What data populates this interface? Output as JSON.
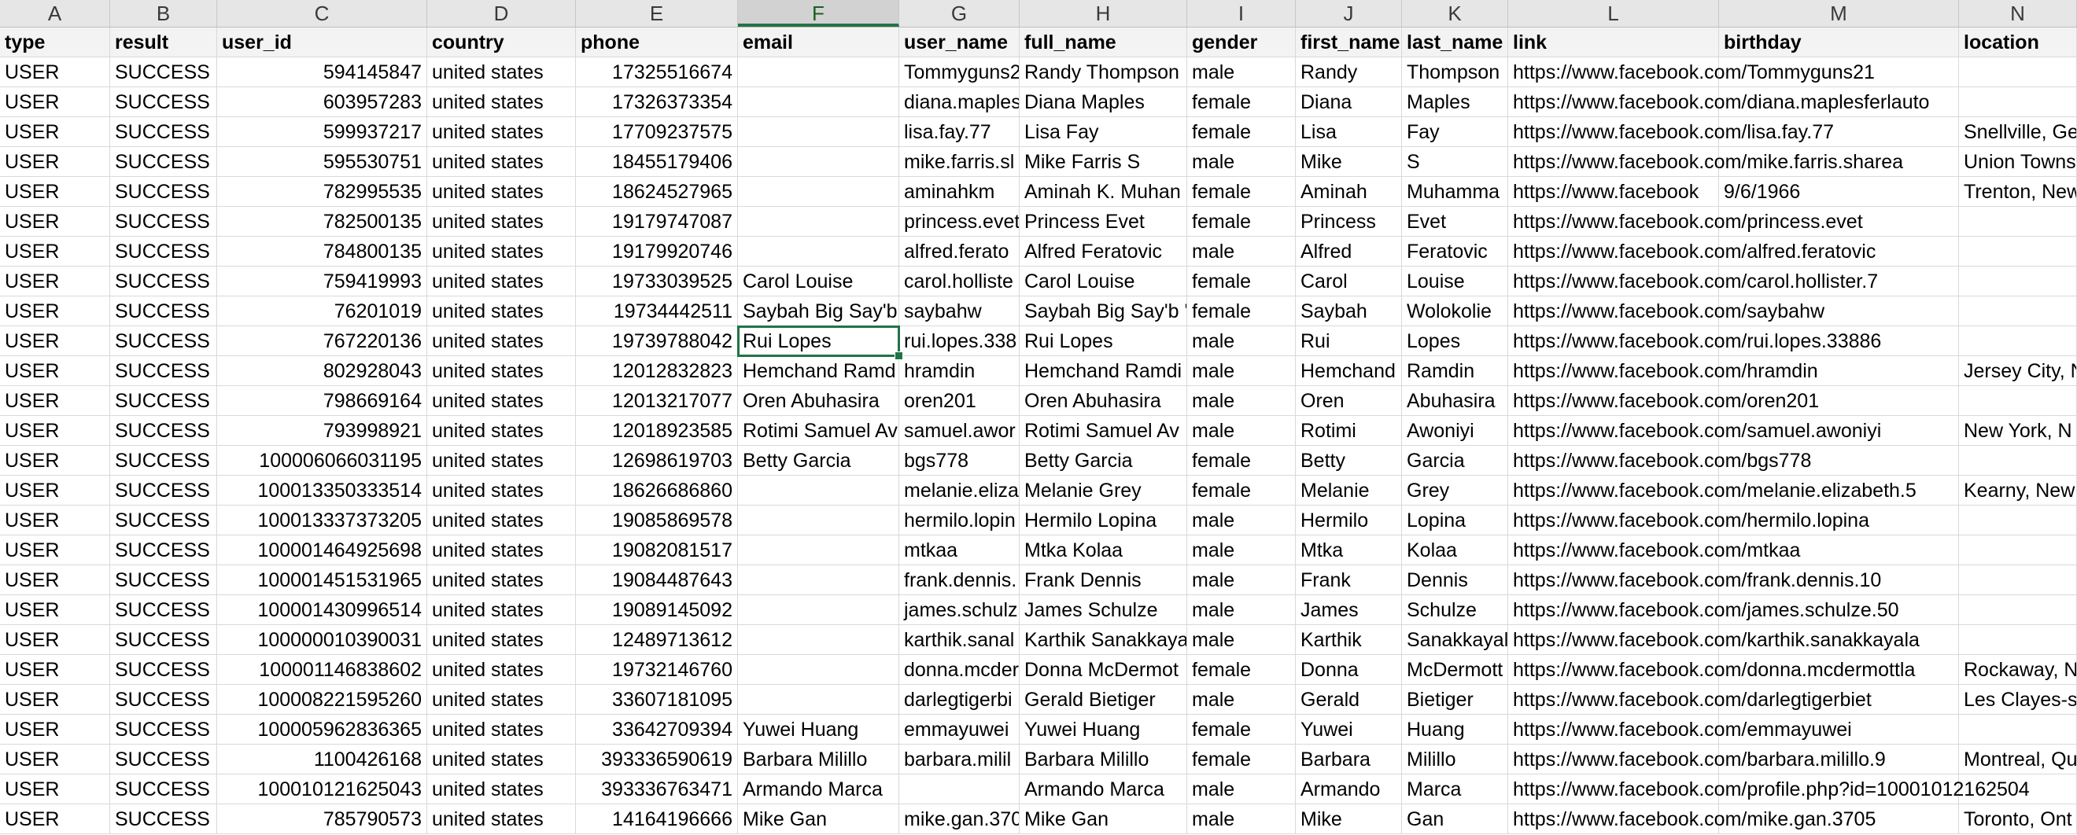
{
  "column_letters": [
    "A",
    "B",
    "C",
    "D",
    "E",
    "F",
    "G",
    "H",
    "I",
    "J",
    "K",
    "L",
    "M",
    "N"
  ],
  "selected_column": "F",
  "headers": [
    "type",
    "result",
    "user_id",
    "country",
    "phone",
    "email",
    "user_name",
    "full_name",
    "gender",
    "first_name",
    "last_name",
    "link",
    "birthday",
    "location"
  ],
  "rows": [
    [
      "USER",
      "SUCCESS",
      "594145847",
      "united states",
      "17325516674",
      "",
      "Tommyguns2",
      "Randy Thompson",
      "male",
      "Randy",
      "Thompson",
      "https://www.facebook.com/Tommyguns21",
      "",
      ""
    ],
    [
      "USER",
      "SUCCESS",
      "603957283",
      "united states",
      "17326373354",
      "",
      "diana.maples",
      "Diana Maples",
      "female",
      "Diana",
      "Maples",
      "https://www.facebook.com/diana.maplesferlauto",
      "",
      ""
    ],
    [
      "USER",
      "SUCCESS",
      "599937217",
      "united states",
      "17709237575",
      "",
      "lisa.fay.77",
      "Lisa Fay",
      "female",
      "Lisa",
      "Fay",
      "https://www.facebook.com/lisa.fay.77",
      "",
      "Snellville, Ge"
    ],
    [
      "USER",
      "SUCCESS",
      "595530751",
      "united states",
      "18455179406",
      "",
      "mike.farris.sl",
      "Mike Farris S",
      "male",
      "Mike",
      "S",
      "https://www.facebook.com/mike.farris.sharea",
      "",
      "Union Towns"
    ],
    [
      "USER",
      "SUCCESS",
      "782995535",
      "united states",
      "18624527965",
      "",
      "aminahkm",
      "Aminah K. Muhan",
      "female",
      "Aminah",
      "Muhamma",
      "https://www.facebook",
      "9/6/1966",
      "Trenton, New"
    ],
    [
      "USER",
      "SUCCESS",
      "782500135",
      "united states",
      "19179747087",
      "",
      "princess.evet",
      "Princess  Evet",
      "female",
      "Princess",
      "Evet",
      "https://www.facebook.com/princess.evet",
      "",
      ""
    ],
    [
      "USER",
      "SUCCESS",
      "784800135",
      "united states",
      "19179920746",
      "",
      "alfred.ferato",
      "Alfred Feratovic",
      "male",
      "Alfred",
      "Feratovic",
      "https://www.facebook.com/alfred.feratovic",
      "",
      ""
    ],
    [
      "USER",
      "SUCCESS",
      "759419993",
      "united states",
      "19733039525",
      "Carol Louise",
      "carol.holliste",
      "Carol Louise",
      "female",
      "Carol",
      "Louise",
      "https://www.facebook.com/carol.hollister.7",
      "",
      ""
    ],
    [
      "USER",
      "SUCCESS",
      "76201019",
      "united states",
      "19734442511",
      "Saybah Big Say'b",
      "saybahw",
      "Saybah Big Say'b '",
      "female",
      "Saybah",
      "Wolokolie",
      "https://www.facebook.com/saybahw",
      "",
      ""
    ],
    [
      "USER",
      "SUCCESS",
      "767220136",
      "united states",
      "19739788042",
      "Rui Lopes",
      "rui.lopes.338",
      "Rui Lopes",
      "male",
      "Rui",
      "Lopes",
      "https://www.facebook.com/rui.lopes.33886",
      "",
      ""
    ],
    [
      "USER",
      "SUCCESS",
      "802928043",
      "united states",
      "12012832823",
      "Hemchand Ramd",
      "hramdin",
      "Hemchand Ramdi",
      "male",
      "Hemchand",
      "Ramdin",
      "https://www.facebook.com/hramdin",
      "",
      "Jersey City, N"
    ],
    [
      "USER",
      "SUCCESS",
      "798669164",
      "united states",
      "12013217077",
      "Oren Abuhasira",
      "oren201",
      "Oren Abuhasira",
      "male",
      "Oren",
      "Abuhasira",
      "https://www.facebook.com/oren201",
      "",
      ""
    ],
    [
      "USER",
      "SUCCESS",
      "793998921",
      "united states",
      "12018923585",
      "Rotimi Samuel Av",
      "samuel.awor",
      "Rotimi Samuel Av",
      "male",
      "Rotimi",
      "Awoniyi",
      "https://www.facebook.com/samuel.awoniyi",
      "",
      "New York, N"
    ],
    [
      "USER",
      "SUCCESS",
      "100006066031195",
      "united states",
      "12698619703",
      "Betty Garcia",
      "bgs778",
      "Betty Garcia",
      "female",
      "Betty",
      "Garcia",
      "https://www.facebook.com/bgs778",
      "",
      ""
    ],
    [
      "USER",
      "SUCCESS",
      "100013350333514",
      "united states",
      "18626686860",
      "",
      "melanie.eliza",
      "Melanie Grey",
      "female",
      "Melanie",
      "Grey",
      "https://www.facebook.com/melanie.elizabeth.5",
      "",
      "Kearny, New"
    ],
    [
      "USER",
      "SUCCESS",
      "100013337373205",
      "united states",
      "19085869578",
      "",
      "hermilo.lopin",
      "Hermilo Lopina",
      "male",
      "Hermilo",
      "Lopina",
      "https://www.facebook.com/hermilo.lopina",
      "",
      ""
    ],
    [
      "USER",
      "SUCCESS",
      "100001464925698",
      "united states",
      "19082081517",
      "",
      "mtkaa",
      "Mtka Kolaa",
      "male",
      "Mtka",
      "Kolaa",
      "https://www.facebook.com/mtkaa",
      "",
      ""
    ],
    [
      "USER",
      "SUCCESS",
      "100001451531965",
      "united states",
      "19084487643",
      "",
      "frank.dennis.",
      "Frank Dennis",
      "male",
      "Frank",
      "Dennis",
      "https://www.facebook.com/frank.dennis.10",
      "",
      ""
    ],
    [
      "USER",
      "SUCCESS",
      "100001430996514",
      "united states",
      "19089145092",
      "",
      "james.schulz",
      "James Schulze",
      "male",
      "James",
      "Schulze",
      "https://www.facebook.com/james.schulze.50",
      "",
      ""
    ],
    [
      "USER",
      "SUCCESS",
      "100000010390031",
      "united states",
      "12489713612",
      "",
      "karthik.sanal",
      "Karthik Sanakkaya",
      "male",
      "Karthik",
      "Sanakkayal",
      "https://www.facebook.com/karthik.sanakkayala",
      "",
      ""
    ],
    [
      "USER",
      "SUCCESS",
      "100001146838602",
      "united states",
      "19732146760",
      "",
      "donna.mcder",
      "Donna McDermot",
      "female",
      "Donna",
      "McDermott",
      "https://www.facebook.com/donna.mcdermottla",
      "",
      "Rockaway, N"
    ],
    [
      "USER",
      "SUCCESS",
      "100008221595260",
      "united states",
      "33607181095",
      "",
      "darlegtigerbi",
      "Gerald Bietiger",
      "male",
      "Gerald",
      "Bietiger",
      "https://www.facebook.com/darlegtigerbiet",
      "",
      "Les Clayes-so"
    ],
    [
      "USER",
      "SUCCESS",
      "100005962836365",
      "united states",
      "33642709394",
      "Yuwei  Huang",
      "emmayuwei",
      "Yuwei  Huang",
      "female",
      "Yuwei",
      "Huang",
      "https://www.facebook.com/emmayuwei",
      "",
      ""
    ],
    [
      "USER",
      "SUCCESS",
      "1100426168",
      "united states",
      "393336590619",
      "Barbara Milillo",
      "barbara.milil",
      "Barbara Milillo",
      "female",
      "Barbara",
      "Milillo",
      "https://www.facebook.com/barbara.milillo.9",
      "",
      "Montreal, Qu"
    ],
    [
      "USER",
      "SUCCESS",
      "100010121625043",
      "united states",
      "393336763471",
      "Armando Marca",
      "",
      "Armando Marca",
      "male",
      "Armando",
      "Marca",
      "https://www.facebook.com/profile.php?id=10001012162504",
      "",
      ""
    ],
    [
      "USER",
      "SUCCESS",
      "785790573",
      "united states",
      "14164196666",
      "Mike Gan",
      "mike.gan.370",
      "Mike Gan",
      "male",
      "Mike",
      "Gan",
      "https://www.facebook.com/mike.gan.3705",
      "",
      "Toronto, Ont"
    ]
  ]
}
